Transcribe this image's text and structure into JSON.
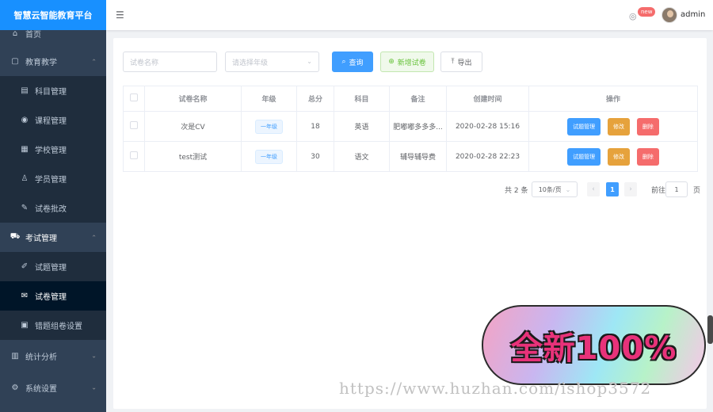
{
  "brand": {
    "title": "智慧云智能教育平台"
  },
  "header": {
    "new_badge": "new",
    "username": "admin"
  },
  "sidebar": {
    "items": [
      {
        "label": "首页",
        "icon": "home-icon",
        "glyph": "⌂"
      },
      {
        "label": "教育教学",
        "icon": "book-icon",
        "glyph": "▢",
        "arrow": "⌃"
      },
      {
        "label": "科目管理",
        "icon": "briefcase-icon",
        "glyph": "▤"
      },
      {
        "label": "课程管理",
        "icon": "eye-icon",
        "glyph": "◉"
      },
      {
        "label": "学校管理",
        "icon": "building-icon",
        "glyph": "▦"
      },
      {
        "label": "学员管理",
        "icon": "user-icon",
        "glyph": "♙"
      },
      {
        "label": "试卷批改",
        "icon": "stamp-icon",
        "glyph": "✎"
      },
      {
        "label": "考试管理",
        "icon": "car-icon",
        "glyph": "⛟",
        "arrow": "⌃"
      },
      {
        "label": "试题管理",
        "icon": "edit-icon",
        "glyph": "✐"
      },
      {
        "label": "试卷管理",
        "icon": "envelope-icon",
        "glyph": "✉"
      },
      {
        "label": "错题组卷设置",
        "icon": "document-icon",
        "glyph": "▣"
      },
      {
        "label": "统计分析",
        "icon": "chart-icon",
        "glyph": "▥",
        "arrow": "⌄"
      },
      {
        "label": "系统设置",
        "icon": "settings-icon",
        "glyph": "⚙",
        "arrow": "⌄"
      }
    ]
  },
  "filters": {
    "paper_name_placeholder": "试卷名称",
    "grade_placeholder": "请选择年级",
    "search_label": "查询",
    "add_label": "新增试卷",
    "export_label": "导出"
  },
  "table": {
    "headers": [
      "试卷名称",
      "年级",
      "总分",
      "科目",
      "备注",
      "创建时间",
      "操作"
    ],
    "rows": [
      {
        "name": "次是CV",
        "grade": "一年级",
        "score": "18",
        "subject": "英语",
        "note": "肥嘟嘟多多多...",
        "created": "2020-02-28 15:16"
      },
      {
        "name": "test测试",
        "grade": "一年级",
        "score": "30",
        "subject": "语文",
        "note": "辅导辅导费",
        "created": "2020-02-28 22:23"
      }
    ],
    "ops": {
      "question_mgmt": "试题管理",
      "edit": "修改",
      "delete": "删除"
    }
  },
  "pagination": {
    "total": "共 2 条",
    "page_size": "10条/页",
    "current": "1",
    "goto_label": "前往",
    "goto_value": "1",
    "page_suffix": "页"
  },
  "promo": {
    "text": "全新100%"
  },
  "watermark": {
    "text": "https://www.huzhan.com/ishop3572"
  },
  "colors": {
    "primary": "#409eff",
    "sidebar": "#304156",
    "brand_bar": "#1890ff",
    "warning": "#e6a23c",
    "danger": "#f56c6c"
  }
}
